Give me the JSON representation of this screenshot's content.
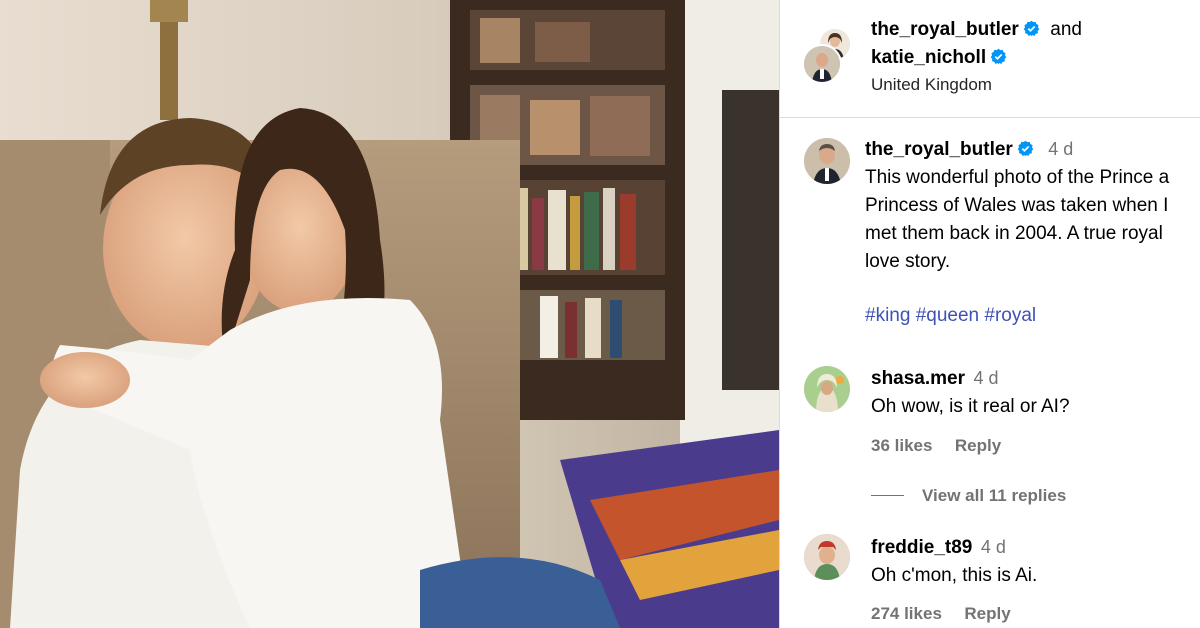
{
  "post": {
    "image_alt": "photo of couple embracing on sofa",
    "header": {
      "user1": "the_royal_butler",
      "and": "and",
      "user2": "katie_nicholl",
      "location": "United Kingdom"
    },
    "caption": {
      "username": "the_royal_butler",
      "time": "4 d",
      "lines": [
        "This wonderful photo of the Prince a",
        "Princess of Wales was taken when I",
        "met them back in 2004. A true royal",
        "love story."
      ],
      "hashtags": [
        "#king",
        "#queen",
        "#royal"
      ]
    },
    "comments": [
      {
        "username": "shasa.mer",
        "time": "4 d",
        "text": "Oh wow, is it real or AI?",
        "likes": "36 likes",
        "reply": "Reply",
        "view_replies": "View all 11 replies"
      },
      {
        "username": "freddie_t89",
        "time": "4 d",
        "text": "Oh c'mon, this is Ai.",
        "likes": "274 likes",
        "reply": "Reply"
      }
    ],
    "colors": {
      "verified_blue": "#0095f6",
      "hashtag": "#3f51b5",
      "muted": "#737373",
      "border": "#dbdbdb"
    }
  }
}
